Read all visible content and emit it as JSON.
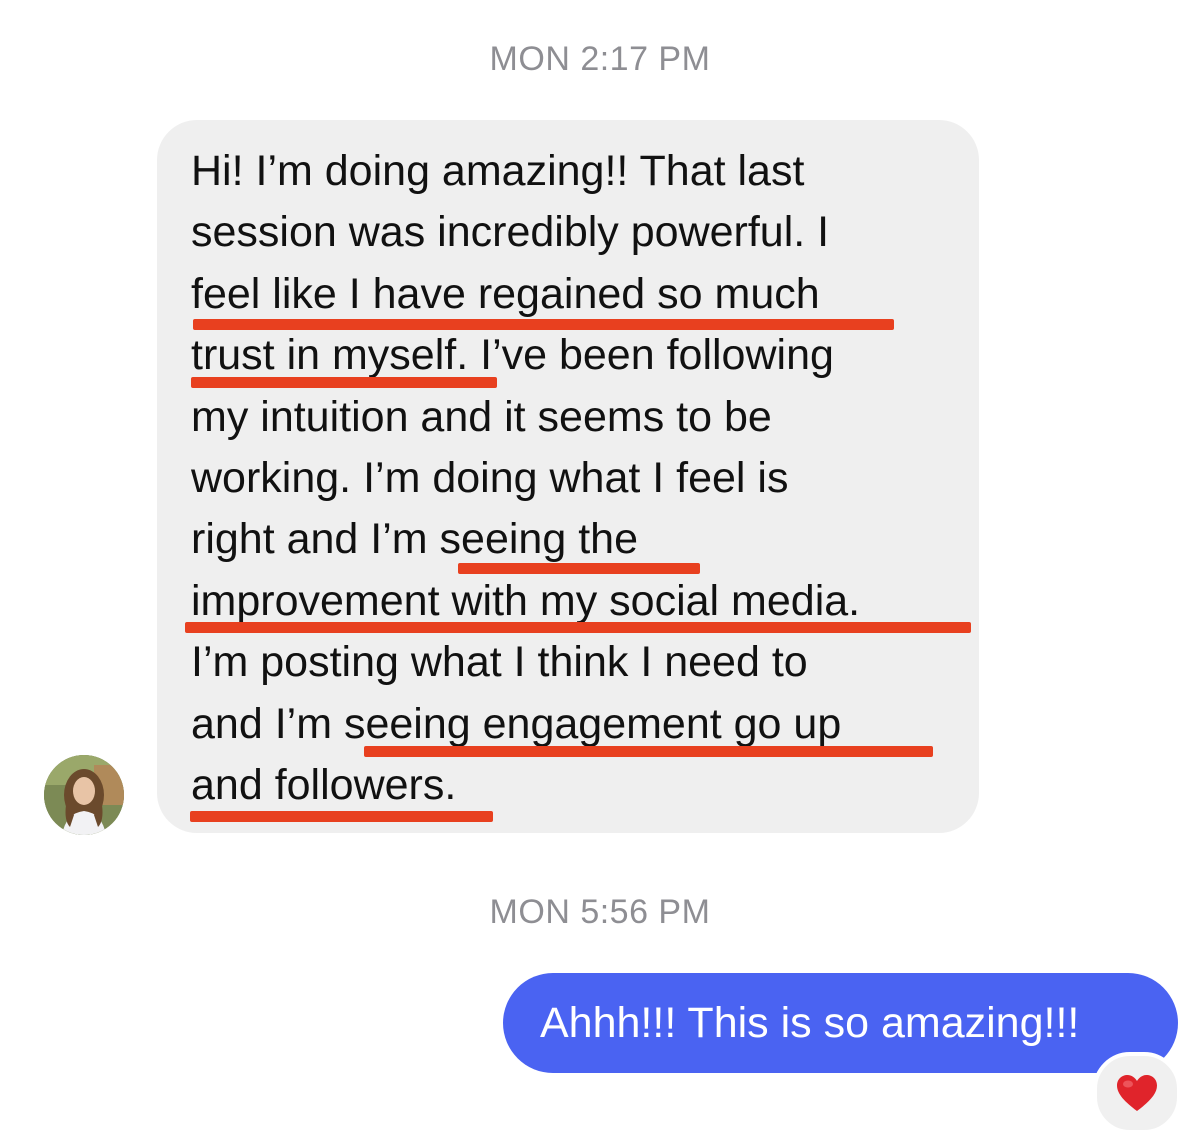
{
  "thread": {
    "timestamp_1": "MON 2:17 PM",
    "timestamp_2": "MON 5:56 PM"
  },
  "incoming_message": {
    "avatar_icon": "user-avatar",
    "lines": [
      "Hi! I’m doing amazing!! That last",
      "session was incredibly powerful. I",
      "feel like I have regained so much",
      "trust in myself. I’ve been following",
      "my intuition and it seems to be",
      "working. I’m doing what I feel is",
      "right and I’m seeing the",
      "improvement with my social media.",
      "I’m posting what I think I need to",
      "and I’m seeing engagement go up",
      "and followers."
    ],
    "highlighted_phrases": [
      "feel like I have regained so much trust in myself.",
      "seeing the improvement with my social media.",
      "seeing engagement go up and followers."
    ],
    "highlight_color": "#e8401f",
    "bubble_color": "#efefef"
  },
  "outgoing_message": {
    "text": "Ahhh!!! This is so amazing!!!",
    "bubble_color": "#4a63f2",
    "reaction": "heart-icon"
  }
}
